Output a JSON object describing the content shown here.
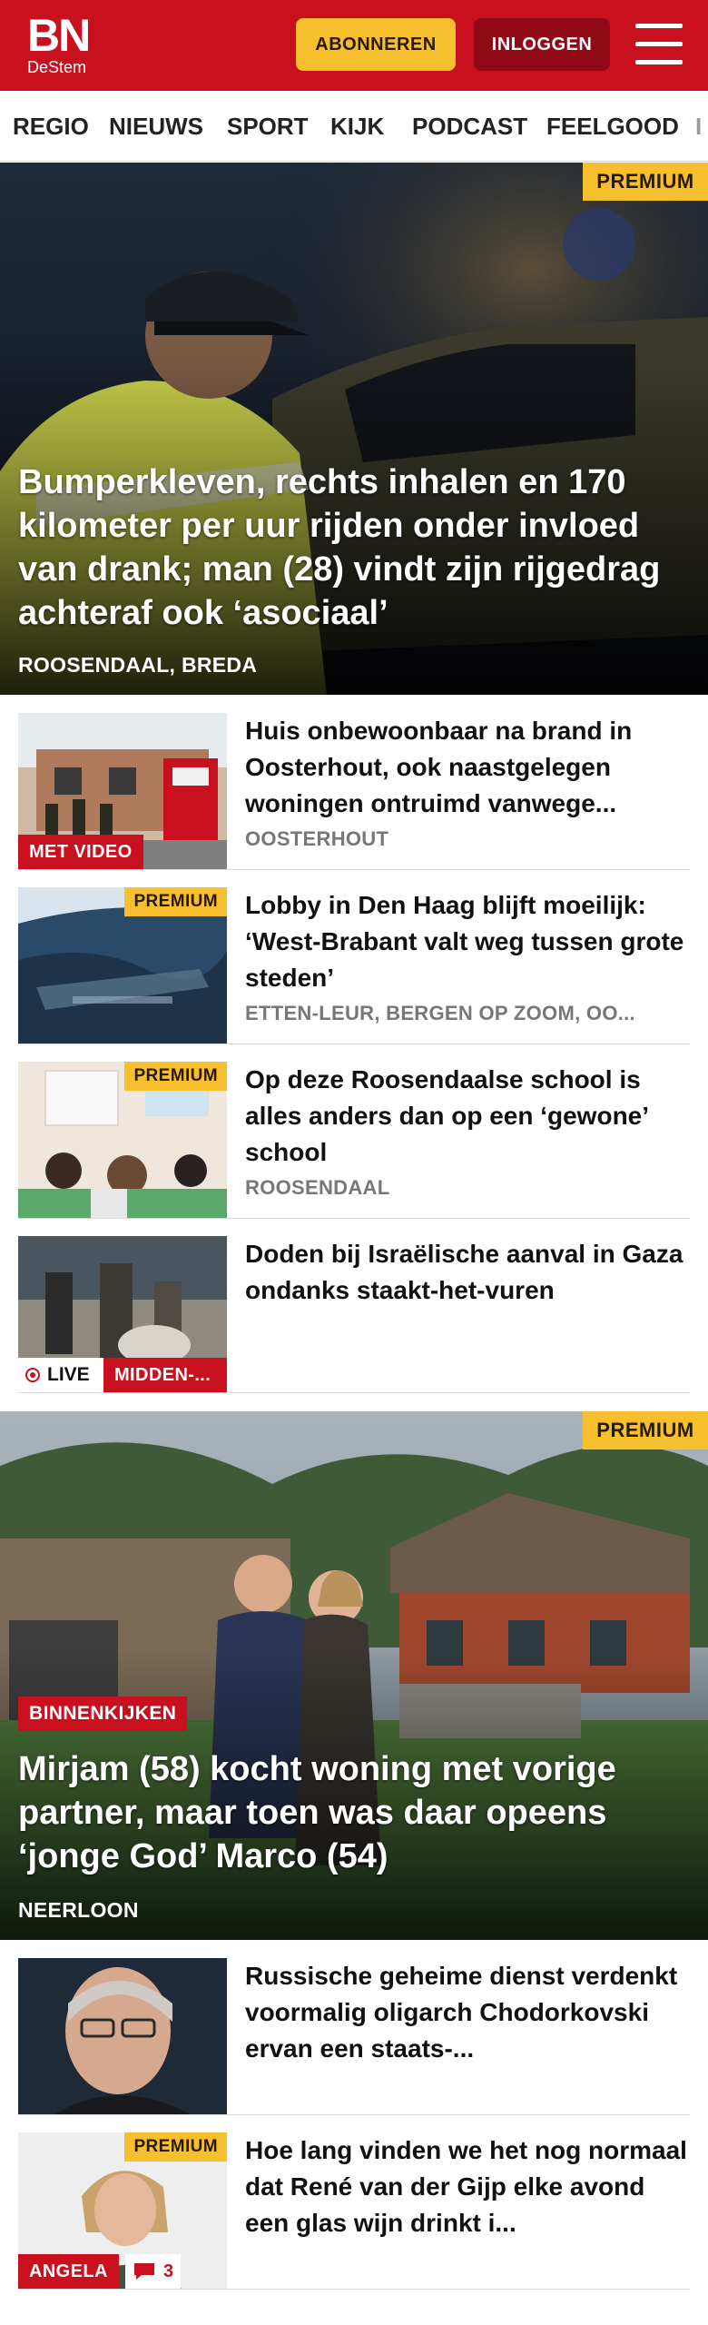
{
  "header": {
    "logo_main": "BN",
    "logo_sub": "DeStem",
    "subscribe_label": "ABONNEREN",
    "login_label": "INLOGGEN",
    "brand_color": "#c8101f",
    "accent_color": "#f5bf2e"
  },
  "nav": {
    "items": [
      {
        "label": "REGIO"
      },
      {
        "label": "NIEUWS"
      },
      {
        "label": "SPORT"
      },
      {
        "label": "KIJK"
      },
      {
        "label": "PODCAST"
      },
      {
        "label": "FEELGOOD"
      },
      {
        "label": "I"
      }
    ]
  },
  "hero1": {
    "badge": "PREMIUM",
    "title": "Bumperkleven, rechts inhalen en 170 kilometer per uur rijden onder invloed van drank; man (28) vindt zijn rijgedrag achteraf ook ‘asociaal’",
    "location": "ROOSENDAAL, BREDA"
  },
  "articles": [
    {
      "title": "Huis onbewoonbaar na brand in Oosterhout, ook naastgelegen woningen ontruimd vanwege...",
      "location": "OOSTERHOUT",
      "tag": "MET VIDEO"
    },
    {
      "badge": "PREMIUM",
      "title": "Lobby in Den Haag blijft moeilijk: ‘West-Brabant valt weg tussen grote steden’",
      "location": "ETTEN-LEUR, BERGEN OP ZOOM, OO..."
    },
    {
      "badge": "PREMIUM",
      "title": "Op deze Roosendaalse school is alles anders dan op een ‘gewone’ school",
      "location": "ROOSENDAAL"
    },
    {
      "title": "Doden bij Israëlische aanval in Gaza ondanks staakt-het-vuren",
      "live_label": "LIVE",
      "tag": "MIDDEN-..."
    }
  ],
  "hero2": {
    "badge": "PREMIUM",
    "category": "BINNENKIJKEN",
    "title": "Mirjam (58) kocht woning met vorige partner, maar toen was daar opeens ‘jonge God’ Marco (54)",
    "location": "NEERLOON"
  },
  "articles2": [
    {
      "title": "Russische geheime dienst verdenkt voormalig oligarch Chodorkovski ervan een staats-..."
    },
    {
      "badge": "PREMIUM",
      "title": "Hoe lang vinden we het nog normaal dat René van der Gijp elke avond een glas wijn drinkt i...",
      "tag": "ANGELA",
      "comments": "3"
    }
  ]
}
